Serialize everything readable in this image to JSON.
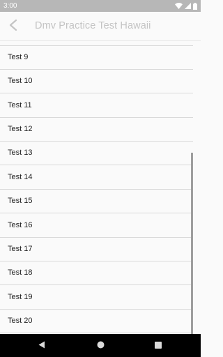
{
  "status_bar": {
    "time": "3:00",
    "icons": [
      "wifi-icon",
      "signal-icon",
      "battery-icon"
    ]
  },
  "app_bar": {
    "title": "Dmv Practice Test Hawaii",
    "back_icon": "back-arrow-icon"
  },
  "tests": [
    {
      "label": "Test 9"
    },
    {
      "label": "Test 10"
    },
    {
      "label": "Test 11"
    },
    {
      "label": "Test 12"
    },
    {
      "label": "Test 13"
    },
    {
      "label": "Test 14"
    },
    {
      "label": "Test 15"
    },
    {
      "label": "Test 16"
    },
    {
      "label": "Test 17"
    },
    {
      "label": "Test 18"
    },
    {
      "label": "Test 19"
    },
    {
      "label": "Test 20"
    }
  ],
  "nav_bar": {
    "buttons": [
      "back-triangle-icon",
      "home-circle-icon",
      "recents-square-icon"
    ]
  },
  "colors": {
    "status_bar": "#b7b7b7",
    "background": "#fafafa",
    "title_text": "#c4c4c4",
    "divider": "#d9d9d9",
    "nav_bar": "#000000"
  }
}
